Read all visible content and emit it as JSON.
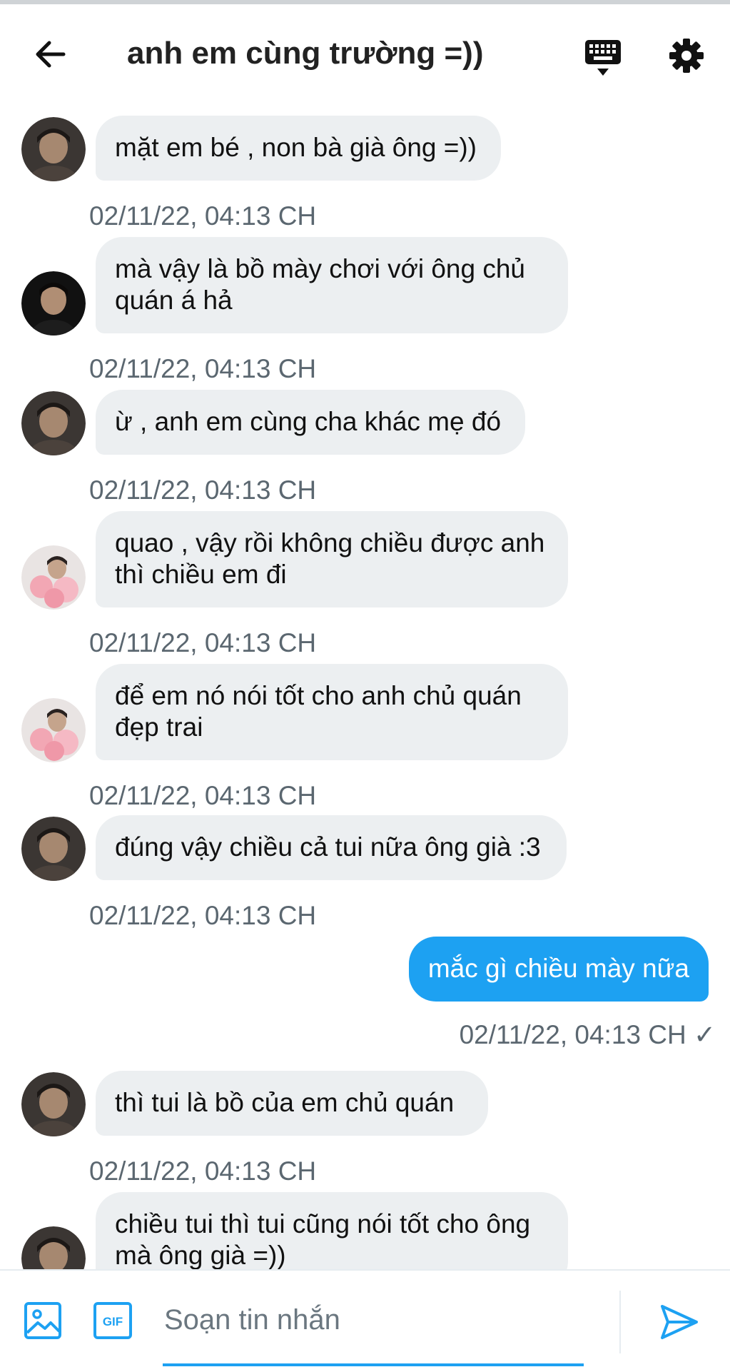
{
  "header": {
    "title": "anh em cùng trường =))",
    "back_icon": "arrow-left-icon",
    "keyboard_icon": "keyboard-icon",
    "settings_icon": "gear-icon"
  },
  "messages": [
    {
      "direction": "in",
      "avatar": "avatar-a",
      "text": "mặt em bé , non bà già ông =))",
      "time": "02/11/22, 04:13 CH"
    },
    {
      "direction": "in",
      "avatar": "avatar-b",
      "text": "mà vậy là bồ mày chơi với ông chủ quán á hả",
      "time": "02/11/22, 04:13 CH"
    },
    {
      "direction": "in",
      "avatar": "avatar-a",
      "text": "ừ , anh em cùng cha khác mẹ đó",
      "time": "02/11/22, 04:13 CH"
    },
    {
      "direction": "in",
      "avatar": "avatar-c",
      "text": "quao , vậy rồi không chiều được anh thì chiều em đi",
      "time": "02/11/22, 04:13 CH"
    },
    {
      "direction": "in",
      "avatar": "avatar-c",
      "text": "để em nó nói tốt cho anh chủ quán đẹp trai",
      "time": "02/11/22, 04:13 CH"
    },
    {
      "direction": "in",
      "avatar": "avatar-a",
      "text": "đúng vậy chiều cả tui nữa ông già :3",
      "time": "02/11/22, 04:13 CH"
    },
    {
      "direction": "out",
      "text": "mắc gì chiều mày nữa",
      "time": "02/11/22, 04:13 CH ✓"
    },
    {
      "direction": "in",
      "avatar": "avatar-a",
      "text": "thì tui là bồ của em chủ quán",
      "time": "02/11/22, 04:13 CH"
    },
    {
      "direction": "in",
      "avatar": "avatar-a",
      "text": "chiều tui thì tui cũng nói tốt cho ông mà ông già =))",
      "time": ""
    }
  ],
  "composer": {
    "placeholder": "Soạn tin nhắn",
    "gif_label": "GIF",
    "image_icon": "image-icon",
    "send_icon": "send-icon"
  },
  "colors": {
    "accent": "#1da1f2",
    "incoming_bubble": "#eceff1",
    "timestamp": "#5b6770"
  }
}
